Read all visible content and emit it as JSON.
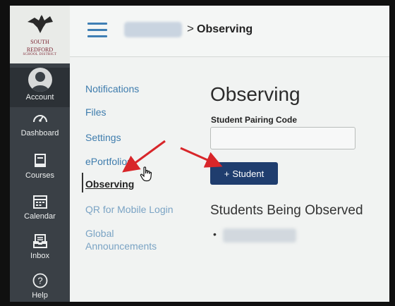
{
  "logo": {
    "line1": "SOUTH",
    "line2": "REDFORD",
    "line3": "SCHOOL DISTRICT"
  },
  "global_nav": {
    "items": [
      {
        "label": "Account",
        "icon": "account-icon"
      },
      {
        "label": "Dashboard",
        "icon": "dashboard-icon"
      },
      {
        "label": "Courses",
        "icon": "courses-icon"
      },
      {
        "label": "Calendar",
        "icon": "calendar-icon"
      },
      {
        "label": "Inbox",
        "icon": "inbox-icon"
      },
      {
        "label": "Help",
        "icon": "help-icon"
      }
    ]
  },
  "header": {
    "breadcrumb_separator": ">",
    "breadcrumb_current": "Observing"
  },
  "profile_menu": {
    "items": [
      {
        "label": "Notifications"
      },
      {
        "label": "Files"
      },
      {
        "label": "Settings"
      },
      {
        "label": "ePortfolios"
      },
      {
        "label": "Observing"
      },
      {
        "label": "QR for Mobile Login"
      },
      {
        "label": "Global Announcements"
      }
    ]
  },
  "main": {
    "title": "Observing",
    "pairing_code_label": "Student Pairing Code",
    "pairing_code_value": "",
    "add_button_icon": "+",
    "add_button_label": "Student",
    "students_heading": "Students Being Observed",
    "bullet": "•"
  },
  "colors": {
    "nav_bg": "#3a4046",
    "link": "#3e7cad",
    "button_bg": "#1f3d6e",
    "annotation_arrow": "#d8262a"
  }
}
